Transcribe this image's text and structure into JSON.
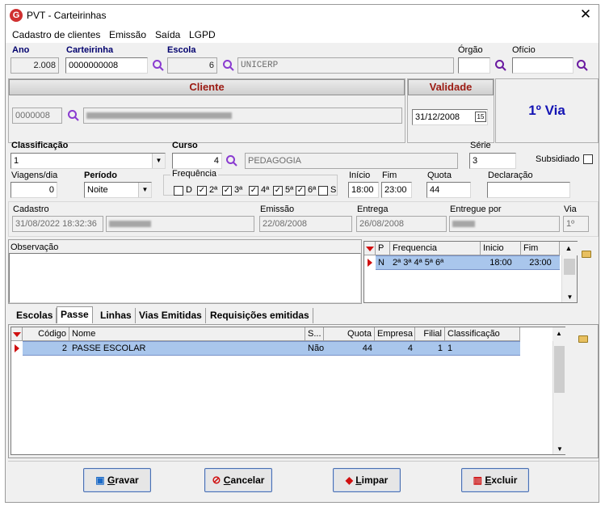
{
  "window": {
    "title": "PVT - Carteirinhas",
    "close_glyph": "✕",
    "app_icon_letter": "G"
  },
  "menu": [
    "Cadastro de clientes",
    "Emissão",
    "Saída",
    "LGPD"
  ],
  "top": {
    "ano_label": "Ano",
    "ano_value": "2.008",
    "carteirinha_label": "Carteirinha",
    "carteirinha_value": "0000000008",
    "escola_label": "Escola",
    "escola_code": "6",
    "escola_name": "UNICERP",
    "orgao_label": "Órgão",
    "orgao_value": "",
    "oficio_label": "Ofício",
    "oficio_value": ""
  },
  "cliente": {
    "header": "Cliente",
    "code": "0000008"
  },
  "validade": {
    "header": "Validade",
    "date": "31/12/2008",
    "cal_glyph": "15"
  },
  "via_text": "1º Via",
  "classificacao": {
    "label": "Classificação",
    "value": "1"
  },
  "curso": {
    "label": "Curso",
    "code": "4",
    "name": "PEDAGOGIA"
  },
  "serie": {
    "label": "Série",
    "value": "3"
  },
  "subsidiado": {
    "label": "Subsidiado",
    "checked": false
  },
  "viagens": {
    "label": "Viagens/dia",
    "value": "0"
  },
  "periodo": {
    "label": "Período",
    "value": "Noite"
  },
  "frequencia": {
    "label": "Frequência",
    "days": [
      {
        "label": "D",
        "checked": false
      },
      {
        "label": "2ª",
        "checked": true
      },
      {
        "label": "3ª",
        "checked": true
      },
      {
        "label": "4ª",
        "checked": true
      },
      {
        "label": "5ª",
        "checked": true
      },
      {
        "label": "6ª",
        "checked": true
      },
      {
        "label": "S",
        "checked": false
      }
    ]
  },
  "inicio": {
    "label": "Início",
    "value": "18:00"
  },
  "fim": {
    "label": "Fim",
    "value": "23:00"
  },
  "quota": {
    "label": "Quota",
    "value": "44"
  },
  "declaracao": {
    "label": "Declaração",
    "value": ""
  },
  "info": {
    "cadastro_label": "Cadastro",
    "cadastro_value": "31/08/2022 18:32:36",
    "emissao_label": "Emissão",
    "emissao_value": "22/08/2008",
    "entrega_label": "Entrega",
    "entrega_value": "26/08/2008",
    "entregue_label": "Entregue por",
    "via_label": "Via",
    "via_value": "1º"
  },
  "observacao_label": "Observação",
  "freq_grid": {
    "headers": [
      "P",
      "Frequencia",
      "Inicio",
      "Fim"
    ],
    "rows": [
      {
        "p": "N",
        "freq": "2ª 3ª 4ª 5ª 6ª",
        "inicio": "18:00",
        "fim": "23:00"
      }
    ]
  },
  "tabs": [
    "Escolas",
    "Passe",
    "Linhas",
    "Vias Emitidas",
    "Requisições emitidas"
  ],
  "passe_grid": {
    "headers": [
      "Código",
      "Nome",
      "S...",
      "Quota",
      "Empresa",
      "Filial",
      "Classificação"
    ],
    "rows": [
      {
        "codigo": "2",
        "nome": "PASSE ESCOLAR",
        "s": "Não",
        "quota": "44",
        "empresa": "4",
        "filial": "1",
        "classificacao": "1"
      }
    ]
  },
  "buttons": [
    {
      "u": "G",
      "rest": "ravar",
      "icon": "save-icon"
    },
    {
      "u": "C",
      "rest": "ancelar",
      "icon": "cancel-icon"
    },
    {
      "u": "L",
      "rest": "impar",
      "icon": "eraser-icon"
    },
    {
      "u": "E",
      "rest": "xcluir",
      "icon": "trash-icon"
    }
  ],
  "colors": {
    "accent_label": "#00006e",
    "panel_red": "#9b1a12",
    "via_blue": "#1414b4",
    "selection": "#a9c6ec"
  }
}
